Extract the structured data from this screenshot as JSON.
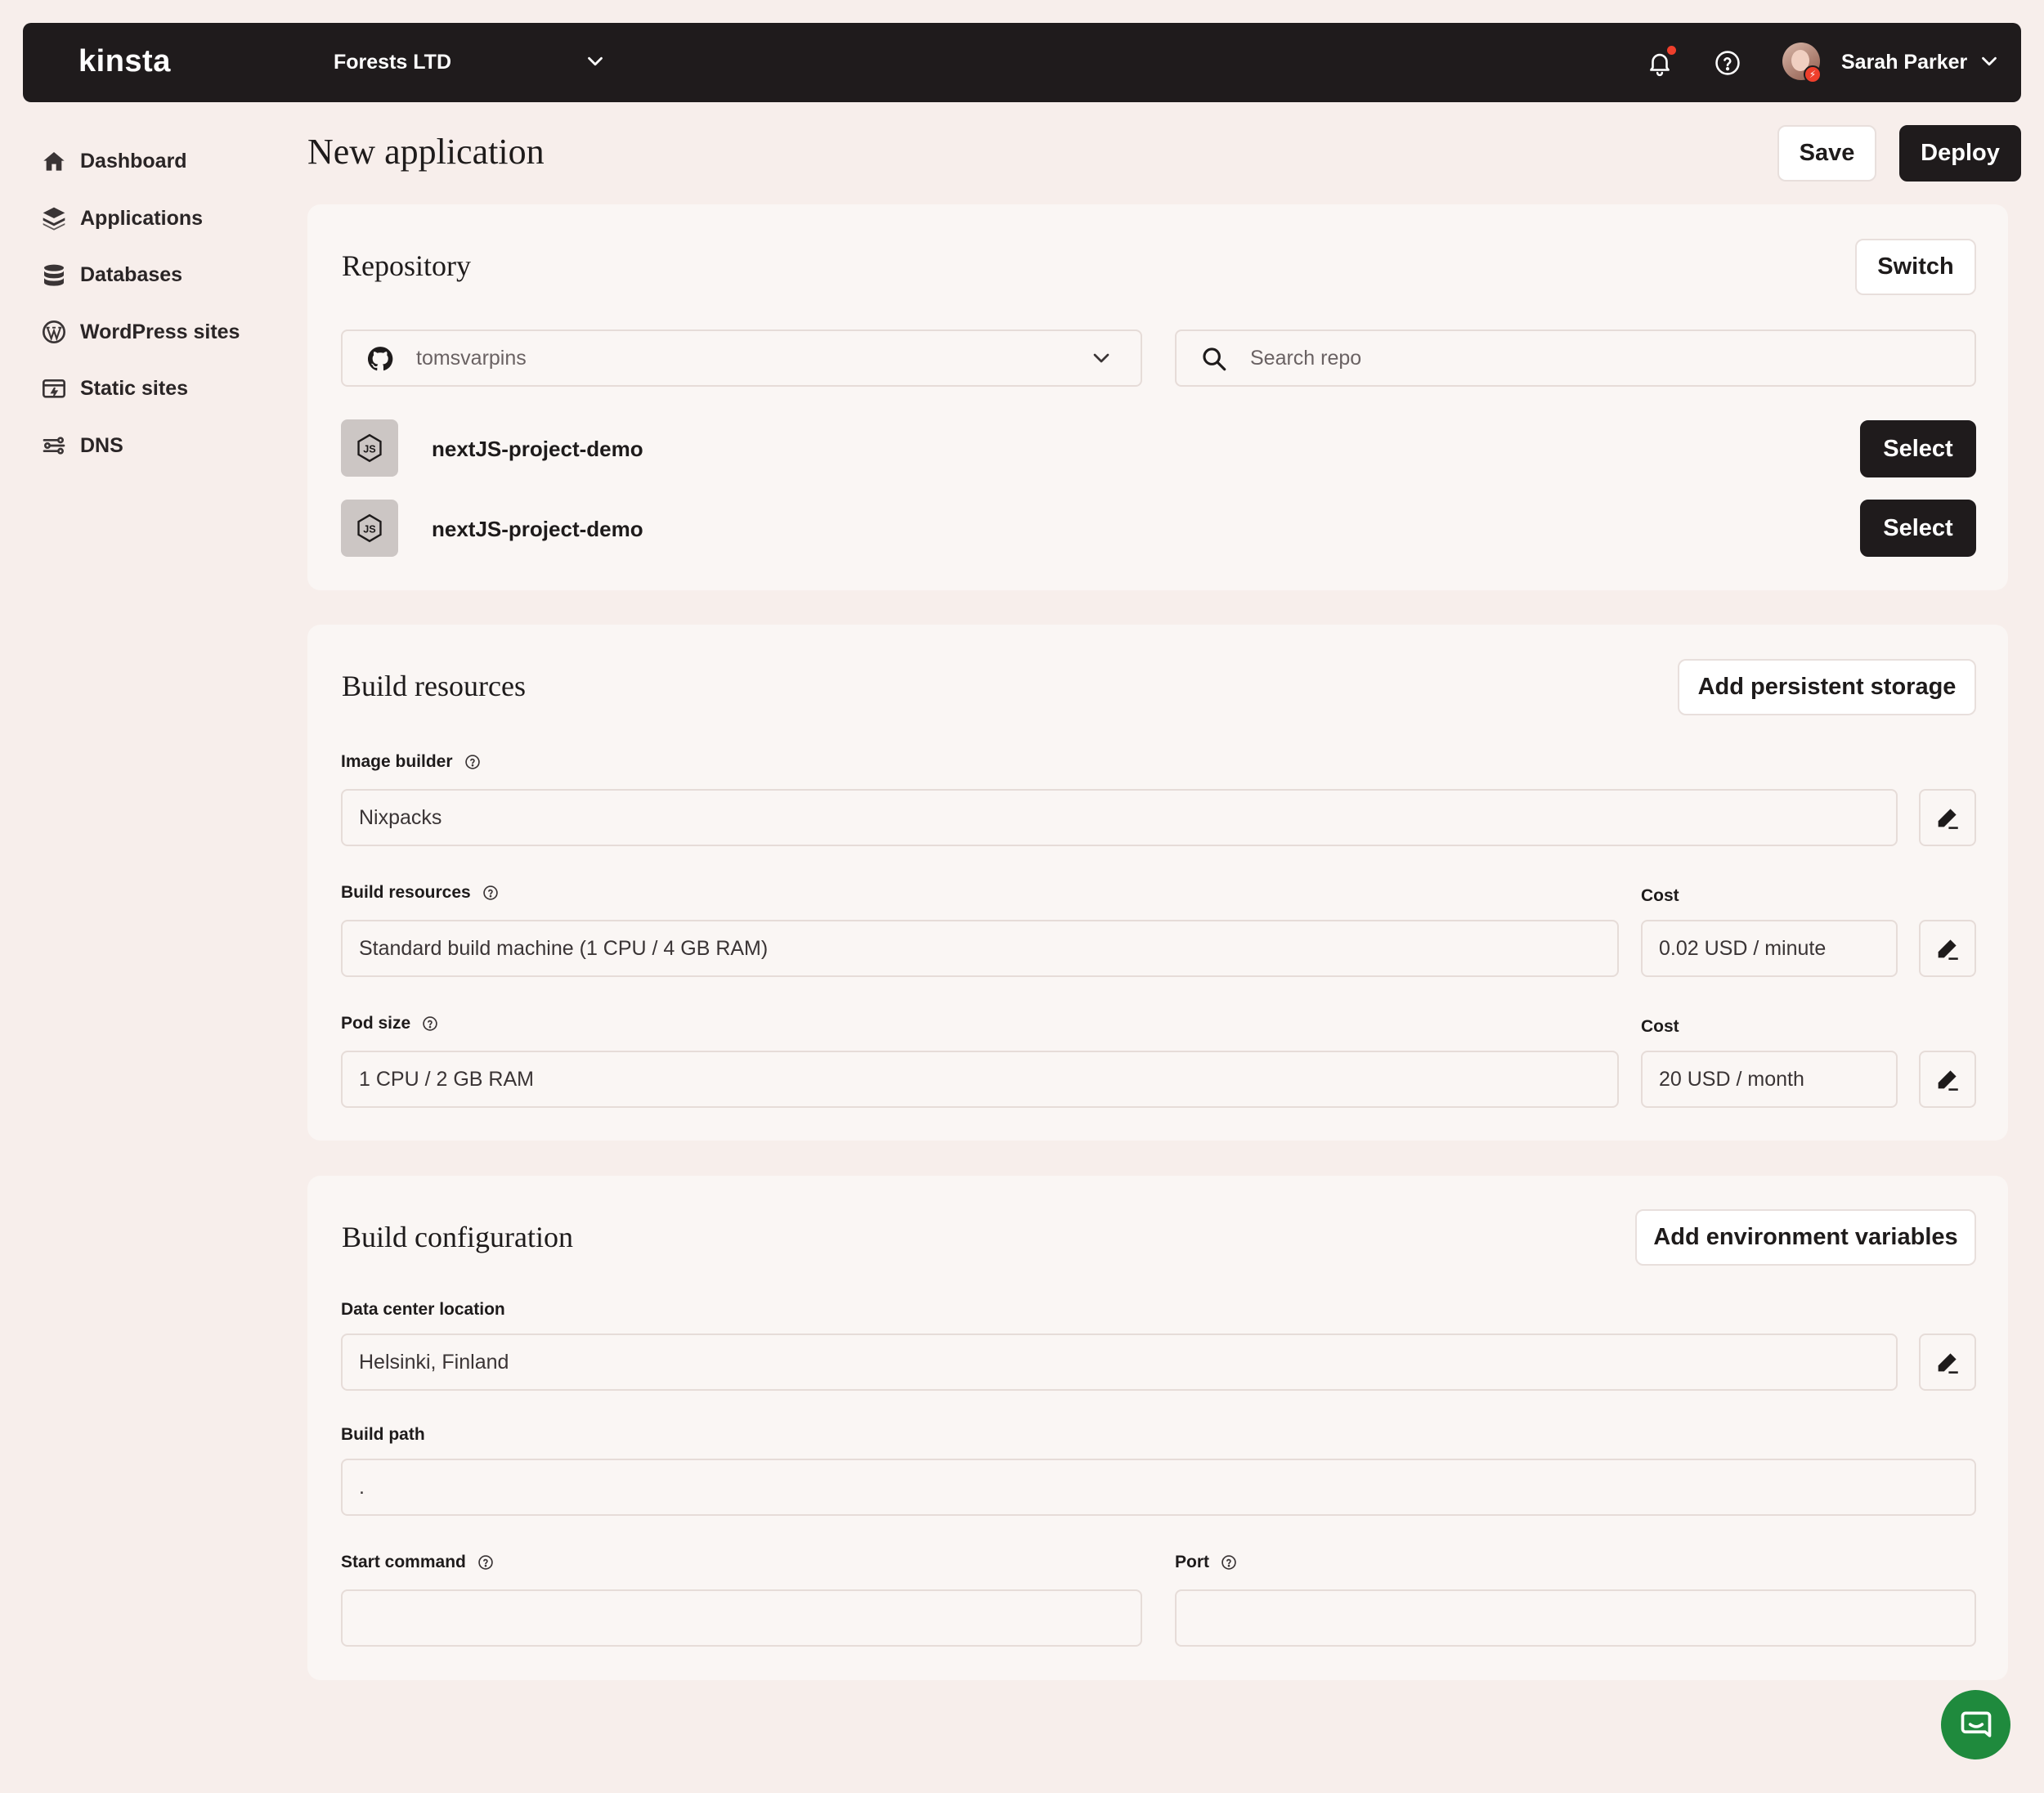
{
  "topbar": {
    "logo": "kinsta",
    "company": "Forests LTD",
    "user_name": "Sarah Parker"
  },
  "sidebar": {
    "items": [
      {
        "label": "Dashboard",
        "icon": "home-icon"
      },
      {
        "label": "Applications",
        "icon": "layers-icon"
      },
      {
        "label": "Databases",
        "icon": "database-icon"
      },
      {
        "label": "WordPress sites",
        "icon": "wordpress-icon"
      },
      {
        "label": "Static sites",
        "icon": "static-site-icon"
      },
      {
        "label": "DNS",
        "icon": "dns-icon"
      }
    ]
  },
  "header": {
    "title": "New application",
    "save_label": "Save",
    "deploy_label": "Deploy"
  },
  "repository": {
    "title": "Repository",
    "switch_label": "Switch",
    "account": "tomsvarpins",
    "search_placeholder": "Search repo",
    "repos": [
      {
        "name": "nextJS-project-demo",
        "select_label": "Select"
      },
      {
        "name": "nextJS-project-demo",
        "select_label": "Select"
      }
    ]
  },
  "build_resources": {
    "title": "Build resources",
    "add_storage_label": "Add persistent storage",
    "image_builder_label": "Image builder",
    "image_builder_value": "Nixpacks",
    "resources_label": "Build resources",
    "resources_value": "Standard build machine (1 CPU / 4 GB RAM)",
    "resources_cost_label": "Cost",
    "resources_cost_value": "0.02 USD / minute",
    "pod_label": "Pod size",
    "pod_value": "1 CPU / 2 GB RAM",
    "pod_cost_label": "Cost",
    "pod_cost_value": "20 USD / month"
  },
  "build_config": {
    "title": "Build configuration",
    "add_env_label": "Add environment variables",
    "datacenter_label": "Data center location",
    "datacenter_value": "Helsinki, Finland",
    "build_path_label": "Build path",
    "build_path_value": ".",
    "start_command_label": "Start command",
    "start_command_value": "",
    "port_label": "Port",
    "port_value": ""
  },
  "colors": {
    "background": "#f7eeeb",
    "topbar": "#1f1b1c",
    "card": "#faf6f4",
    "notification": "#ef3f2c",
    "chat": "#1f8a3d"
  }
}
